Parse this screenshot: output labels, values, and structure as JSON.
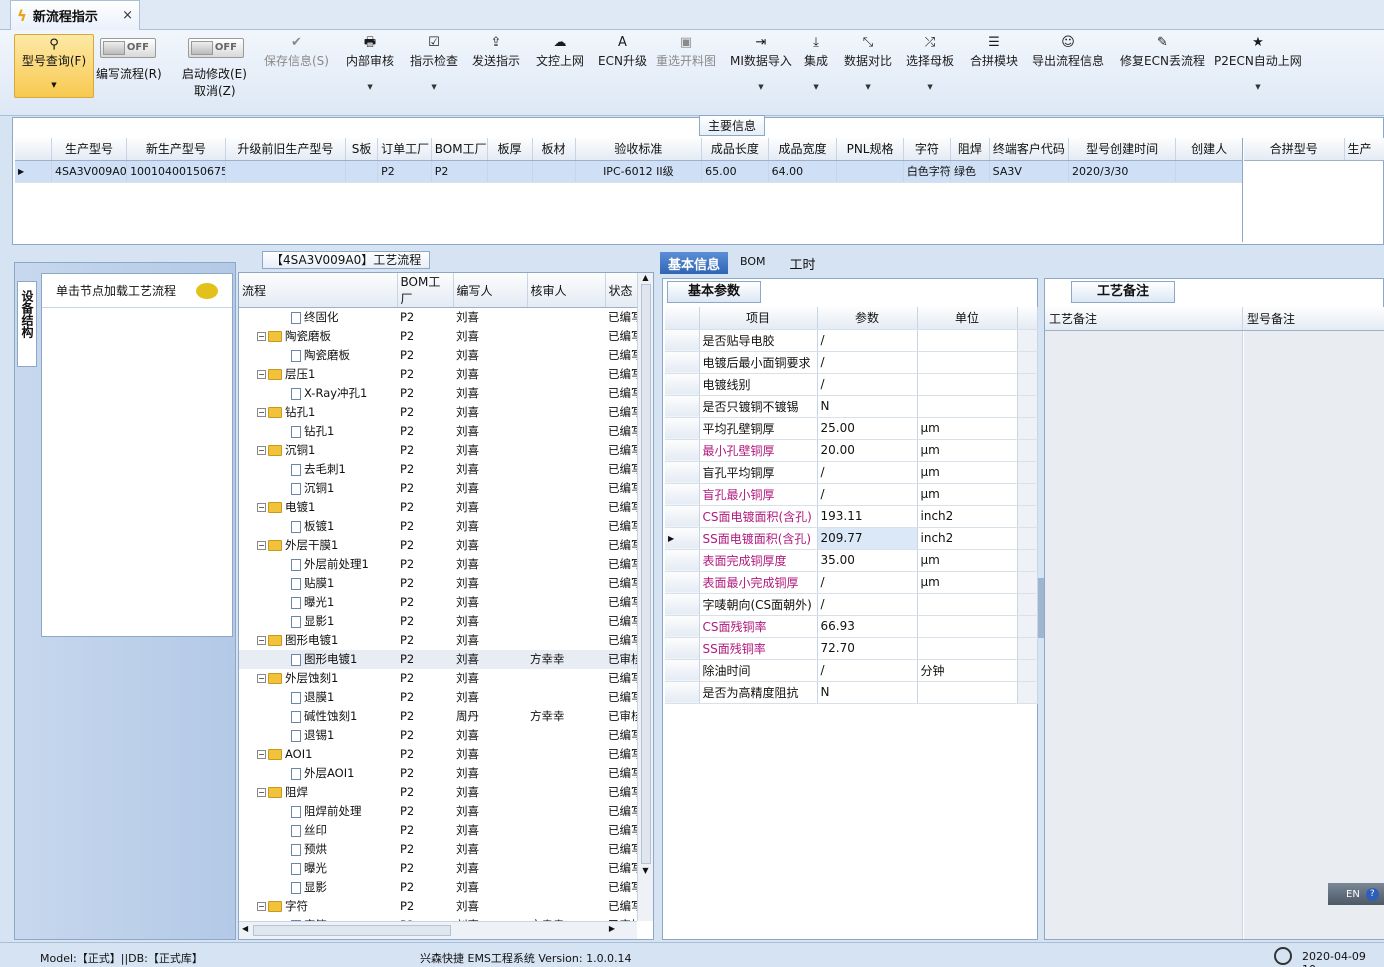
{
  "window": {
    "tab_title": "新流程指示",
    "close": "×"
  },
  "ribbon": {
    "query": {
      "label": "型号查询(F)"
    },
    "toggle_off": "OFF",
    "edit_flow": "编写流程(R)",
    "start_modify": "启动修改(E)",
    "cancel": "取消(Z)",
    "buttons": [
      {
        "label": "保存信息(S)",
        "icon": "✔"
      },
      {
        "label": "内部审核",
        "icon": "🖶"
      },
      {
        "label": "指示检查",
        "icon": "☑"
      },
      {
        "label": "发送指示",
        "icon": "⇪"
      },
      {
        "label": "文控上网",
        "icon": "☁"
      },
      {
        "label": "ECN升级",
        "icon": "A"
      },
      {
        "label": "重选开料图",
        "icon": "▣"
      },
      {
        "label": "MI数据导入",
        "icon": "⇥"
      },
      {
        "label": "集成",
        "icon": "⤓"
      },
      {
        "label": "数据对比",
        "icon": "⤡"
      },
      {
        "label": "选择母板",
        "icon": "⤮"
      },
      {
        "label": "合拼模块",
        "icon": "☰"
      },
      {
        "label": "导出流程信息",
        "icon": "☺"
      },
      {
        "label": "修复ECN丢流程",
        "icon": "✎"
      },
      {
        "label": "P2ECN自动上网",
        "icon": "★"
      }
    ]
  },
  "main_info": {
    "title": "主要信息",
    "columns": [
      "生产型号",
      "新生产型号",
      "升级前旧生产型号",
      "S板",
      "订单工厂",
      "BOM工厂",
      "板厚",
      "板材",
      "验收标准",
      "成品长度",
      "成品宽度",
      "PNL规格",
      "字符",
      "阻焊",
      "终端客户代码",
      "型号创建时间",
      "创建人"
    ],
    "row": [
      "4SA3V009A0",
      "10010400150675",
      "",
      "",
      "P2",
      "P2",
      "",
      "",
      "IPC-6012 II级",
      "65.00",
      "64.00",
      "",
      "白色字符",
      "绿色",
      "SA3V",
      "2020/3/30",
      ""
    ],
    "side_columns": [
      "合拼型号",
      "生产"
    ]
  },
  "left_panel": {
    "vertical_tab": "设备结构",
    "hint": "单击节点加载工艺流程"
  },
  "flow": {
    "title": "【4SA3V009A0】工艺流程",
    "columns": [
      "流程",
      "BOM工厂",
      "编写人",
      "核审人",
      "状态"
    ],
    "rows": [
      {
        "name": "终固化",
        "level": 1,
        "bom": "P2",
        "writer": "刘喜",
        "reviewer": "",
        "status": "已编写"
      },
      {
        "name": "陶瓷磨板",
        "level": 0,
        "bom": "P2",
        "writer": "刘喜",
        "reviewer": "",
        "status": "已编写"
      },
      {
        "name": "陶瓷磨板",
        "level": 1,
        "bom": "P2",
        "writer": "刘喜",
        "reviewer": "",
        "status": "已编写"
      },
      {
        "name": "层压1",
        "level": 0,
        "bom": "P2",
        "writer": "刘喜",
        "reviewer": "",
        "status": "已编写"
      },
      {
        "name": "X-Ray冲孔1",
        "level": 1,
        "bom": "P2",
        "writer": "刘喜",
        "reviewer": "",
        "status": "已编写"
      },
      {
        "name": "钻孔1",
        "level": 0,
        "bom": "P2",
        "writer": "刘喜",
        "reviewer": "",
        "status": "已编写"
      },
      {
        "name": "钻孔1",
        "level": 1,
        "bom": "P2",
        "writer": "刘喜",
        "reviewer": "",
        "status": "已编写"
      },
      {
        "name": "沉铜1",
        "level": 0,
        "bom": "P2",
        "writer": "刘喜",
        "reviewer": "",
        "status": "已编写"
      },
      {
        "name": "去毛刺1",
        "level": 1,
        "bom": "P2",
        "writer": "刘喜",
        "reviewer": "",
        "status": "已编写"
      },
      {
        "name": "沉铜1",
        "level": 1,
        "bom": "P2",
        "writer": "刘喜",
        "reviewer": "",
        "status": "已编写"
      },
      {
        "name": "电镀1",
        "level": 0,
        "bom": "P2",
        "writer": "刘喜",
        "reviewer": "",
        "status": "已编写"
      },
      {
        "name": "板镀1",
        "level": 1,
        "bom": "P2",
        "writer": "刘喜",
        "reviewer": "",
        "status": "已编写"
      },
      {
        "name": "外层干膜1",
        "level": 0,
        "bom": "P2",
        "writer": "刘喜",
        "reviewer": "",
        "status": "已编写"
      },
      {
        "name": "外层前处理1",
        "level": 1,
        "bom": "P2",
        "writer": "刘喜",
        "reviewer": "",
        "status": "已编写"
      },
      {
        "name": "贴膜1",
        "level": 1,
        "bom": "P2",
        "writer": "刘喜",
        "reviewer": "",
        "status": "已编写"
      },
      {
        "name": "曝光1",
        "level": 1,
        "bom": "P2",
        "writer": "刘喜",
        "reviewer": "",
        "status": "已编写"
      },
      {
        "name": "显影1",
        "level": 1,
        "bom": "P2",
        "writer": "刘喜",
        "reviewer": "",
        "status": "已编写"
      },
      {
        "name": "图形电镀1",
        "level": 0,
        "bom": "P2",
        "writer": "刘喜",
        "reviewer": "",
        "status": "已编写"
      },
      {
        "name": "图形电镀1",
        "level": 1,
        "bom": "P2",
        "writer": "刘喜",
        "reviewer": "方幸幸",
        "status": "已审核"
      },
      {
        "name": "外层蚀刻1",
        "level": 0,
        "bom": "P2",
        "writer": "刘喜",
        "reviewer": "",
        "status": "已编写"
      },
      {
        "name": "退膜1",
        "level": 1,
        "bom": "P2",
        "writer": "刘喜",
        "reviewer": "",
        "status": "已编写"
      },
      {
        "name": "碱性蚀刻1",
        "level": 1,
        "bom": "P2",
        "writer": "周丹",
        "reviewer": "方幸幸",
        "status": "已审核"
      },
      {
        "name": "退锡1",
        "level": 1,
        "bom": "P2",
        "writer": "刘喜",
        "reviewer": "",
        "status": "已编写"
      },
      {
        "name": "AOI1",
        "level": 0,
        "bom": "P2",
        "writer": "刘喜",
        "reviewer": "",
        "status": "已编写"
      },
      {
        "name": "外层AOI1",
        "level": 1,
        "bom": "P2",
        "writer": "刘喜",
        "reviewer": "",
        "status": "已编写"
      },
      {
        "name": "阻焊",
        "level": 0,
        "bom": "P2",
        "writer": "刘喜",
        "reviewer": "",
        "status": "已编写"
      },
      {
        "name": "阻焊前处理",
        "level": 1,
        "bom": "P2",
        "writer": "刘喜",
        "reviewer": "",
        "status": "已编写"
      },
      {
        "name": "丝印",
        "level": 1,
        "bom": "P2",
        "writer": "刘喜",
        "reviewer": "",
        "status": "已编写"
      },
      {
        "name": "预烘",
        "level": 1,
        "bom": "P2",
        "writer": "刘喜",
        "reviewer": "",
        "status": "已编写"
      },
      {
        "name": "曝光",
        "level": 1,
        "bom": "P2",
        "writer": "刘喜",
        "reviewer": "",
        "status": "已编写"
      },
      {
        "name": "显影",
        "level": 1,
        "bom": "P2",
        "writer": "刘喜",
        "reviewer": "",
        "status": "已编写"
      },
      {
        "name": "字符",
        "level": 0,
        "bom": "P2",
        "writer": "刘喜",
        "reviewer": "",
        "status": "已编写"
      },
      {
        "name": "字符",
        "level": 1,
        "bom": "P2",
        "writer": "刘喜",
        "reviewer": "方幸幸",
        "status": "已审核"
      }
    ]
  },
  "detail_tabs": [
    "基本信息",
    "BOM",
    "工时"
  ],
  "basic": {
    "tab": "基本参数",
    "columns": [
      "项目",
      "参数",
      "单位"
    ],
    "rows": [
      {
        "item": "是否贴导电胶",
        "value": "/",
        "unit": "",
        "hl": false
      },
      {
        "item": "电镀后最小面铜要求",
        "value": "/",
        "unit": "",
        "hl": false
      },
      {
        "item": "电镀线别",
        "value": "/",
        "unit": "",
        "hl": false
      },
      {
        "item": "是否只镀铜不镀锡",
        "value": "N",
        "unit": "",
        "hl": false
      },
      {
        "item": "平均孔壁铜厚",
        "value": "25.00",
        "unit": "μm",
        "hl": false
      },
      {
        "item": "最小孔壁铜厚",
        "value": "20.00",
        "unit": "μm",
        "hl": true
      },
      {
        "item": "盲孔平均铜厚",
        "value": "/",
        "unit": "μm",
        "hl": false
      },
      {
        "item": "盲孔最小铜厚",
        "value": "/",
        "unit": "μm",
        "hl": true
      },
      {
        "item": "CS面电镀面积(含孔)",
        "value": "193.11",
        "unit": "inch2",
        "hl": true
      },
      {
        "item": "SS面电镀面积(含孔)",
        "value": "209.77",
        "unit": "inch2",
        "hl": true,
        "sel": true
      },
      {
        "item": "表面完成铜厚度",
        "value": "35.00",
        "unit": "μm",
        "hl": true
      },
      {
        "item": "表面最小完成铜厚",
        "value": "/",
        "unit": "μm",
        "hl": true
      },
      {
        "item": "字唛朝向(CS面朝外)",
        "value": "/",
        "unit": "",
        "hl": false
      },
      {
        "item": "CS面残铜率",
        "value": "66.93",
        "unit": "",
        "hl": true
      },
      {
        "item": "SS面残铜率",
        "value": "72.70",
        "unit": "",
        "hl": true
      },
      {
        "item": "除油时间",
        "value": "/",
        "unit": "分钟",
        "hl": false
      },
      {
        "item": "是否为高精度阻抗",
        "value": "N",
        "unit": "",
        "hl": false
      }
    ]
  },
  "notes": {
    "tab": "工艺备注",
    "col1": "工艺备注",
    "col2": "型号备注"
  },
  "lang": "EN",
  "status": {
    "model": "Model:【正式】||DB:【正式库】",
    "system": "兴森快捷 EMS工程系统 Version: 1.0.0.14",
    "date": "2020-04-09 10:"
  },
  "colors": {
    "highlight_text": "#b0197e",
    "selection": "#dbe8f8",
    "accent": "#f8c94f"
  }
}
